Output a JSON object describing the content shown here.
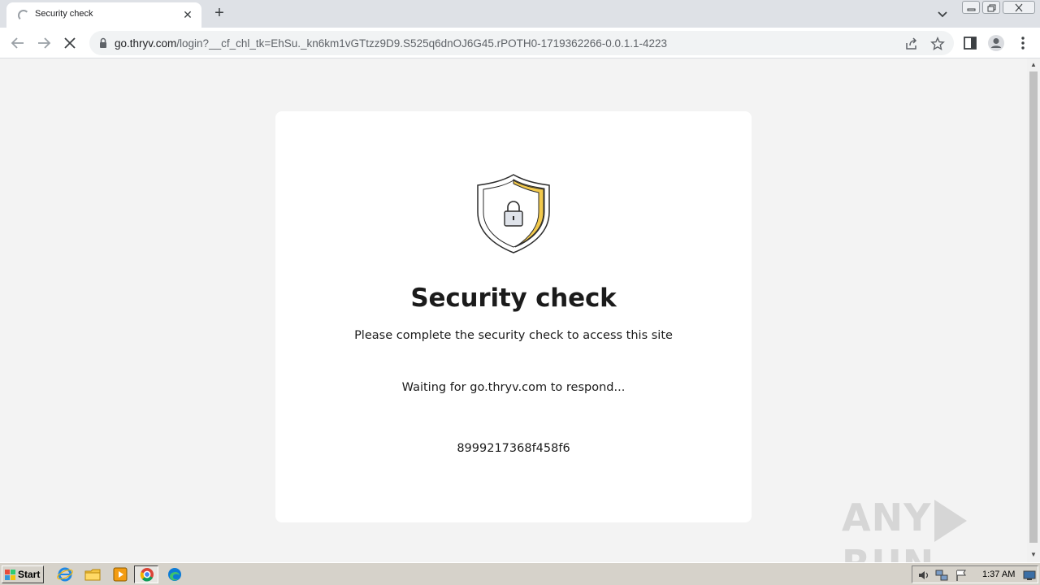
{
  "browser": {
    "tab": {
      "title": "Security check",
      "close_glyph": "✕"
    },
    "new_tab_glyph": "+",
    "url": {
      "host": "go.thryv.com",
      "path": "/login?__cf_chl_tk=EhSu._kn6km1vGTtzz9D9.S525q6dnOJ6G45.rPOTH0-1719362266-0.0.1.1-4223"
    },
    "icons": [
      "back-icon",
      "forward-icon",
      "stop-icon",
      "lock-icon",
      "share-icon",
      "bookmark-star-icon",
      "side-panel-icon",
      "profile-icon",
      "menu-icon"
    ]
  },
  "page": {
    "heading": "Security check",
    "subtitle": "Please complete the security check to access this site",
    "waiting": "Waiting for go.thryv.com to respond...",
    "ray_id": "8999217368f458f6",
    "shield_accent": "#f2c94c",
    "background": "#f3f3f3",
    "card_background": "#ffffff"
  },
  "watermark": {
    "left": "ANY",
    "right": "RUN"
  },
  "taskbar": {
    "start_label": "Start",
    "clock": "1:37 AM",
    "apps": [
      "ie-icon",
      "explorer-icon",
      "media-player-icon",
      "chrome-icon",
      "edge-icon"
    ],
    "tray_icons": [
      "volume-icon",
      "network-icon",
      "flag-icon",
      "display-icon"
    ]
  }
}
